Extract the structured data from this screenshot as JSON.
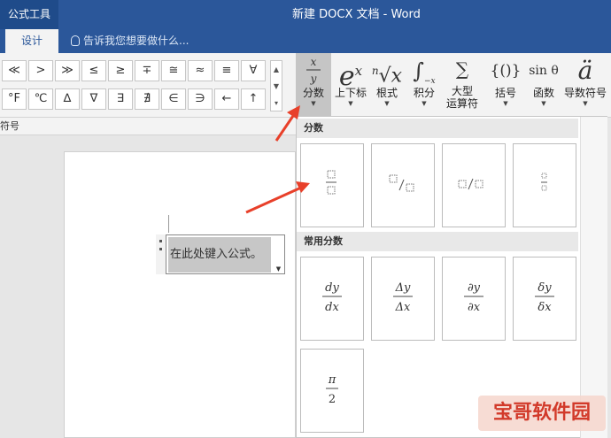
{
  "titlebar": {
    "context_tab": "公式工具",
    "document_title": "新建 DOCX 文档 - Word"
  },
  "tabs": {
    "design": "设计",
    "tell_me": "告诉我您想要做什么..."
  },
  "ribbon": {
    "symbols": [
      "≪",
      ">",
      "≫",
      "≤",
      "≥",
      "∓",
      "≅",
      "≈",
      "≡",
      "∀",
      "°F",
      "℃",
      "∆",
      "∇",
      "∃",
      "∄",
      "∈",
      "∋",
      "←",
      "↑"
    ],
    "group_label": "符号",
    "buttons": [
      {
        "icon_text": "x/y",
        "label": "分数"
      },
      {
        "icon_text": "eˣ",
        "label": "上下标"
      },
      {
        "icon_text": "ⁿ√x",
        "label": "根式"
      },
      {
        "icon_text": "∫",
        "label": "积分"
      },
      {
        "icon_text": "∑",
        "label": "大型\n运算符"
      },
      {
        "icon_text": "{()}",
        "label": "括号"
      },
      {
        "icon_text": "sin θ",
        "label": "函数"
      },
      {
        "icon_text": "ä",
        "label": "导数符号"
      }
    ],
    "big_operator_line1": "大型",
    "big_operator_line2": "运算符"
  },
  "document": {
    "placeholder": "在此处键入公式。"
  },
  "gallery": {
    "section_fraction": "分数",
    "section_common": "常用分数",
    "common": [
      {
        "num": "dy",
        "den": "dx"
      },
      {
        "num": "Δy",
        "den": "Δx"
      },
      {
        "num": "∂y",
        "den": "∂x"
      },
      {
        "num": "δy",
        "den": "δx"
      },
      {
        "num": "π",
        "den": "2"
      }
    ]
  },
  "watermark": "宝哥软件园"
}
